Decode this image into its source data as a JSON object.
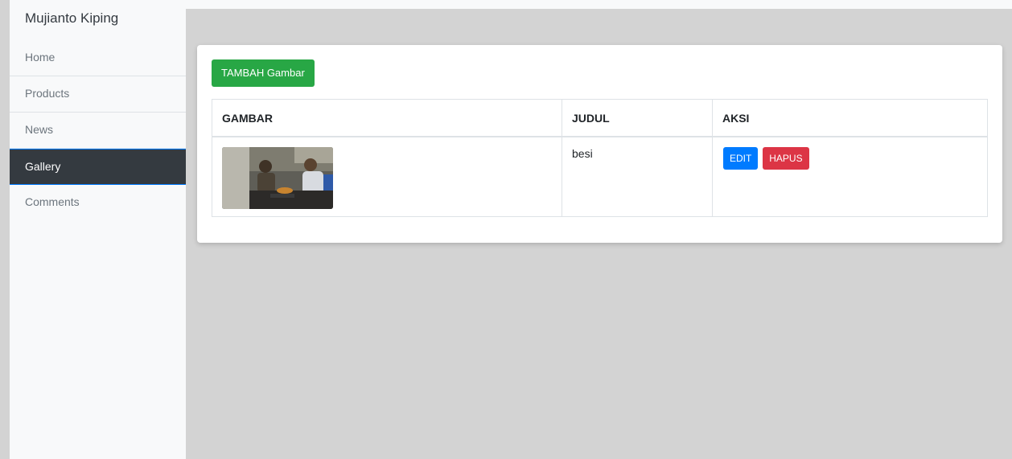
{
  "sidebar": {
    "brand": "Mujianto Kiping",
    "items": [
      {
        "label": "Home",
        "active": false
      },
      {
        "label": "Products",
        "active": false
      },
      {
        "label": "News",
        "active": false
      },
      {
        "label": "Gallery",
        "active": true
      },
      {
        "label": "Comments",
        "active": false
      }
    ]
  },
  "main": {
    "add_button_label": "TAMBAH Gambar",
    "table": {
      "headers": [
        "GAMBAR",
        "JUDUL",
        "AKSI"
      ],
      "rows": [
        {
          "image_icon": "photo-of-blacksmiths",
          "title": "besi",
          "edit_label": "EDIT",
          "delete_label": "HAPUS"
        }
      ]
    }
  },
  "colors": {
    "sidebar_bg": "#f8f9fa",
    "active_bg": "#343a40",
    "page_bg": "#d3d3d3",
    "add_button": "#28a745",
    "edit_button": "#007bff",
    "delete_button": "#dc3545"
  }
}
